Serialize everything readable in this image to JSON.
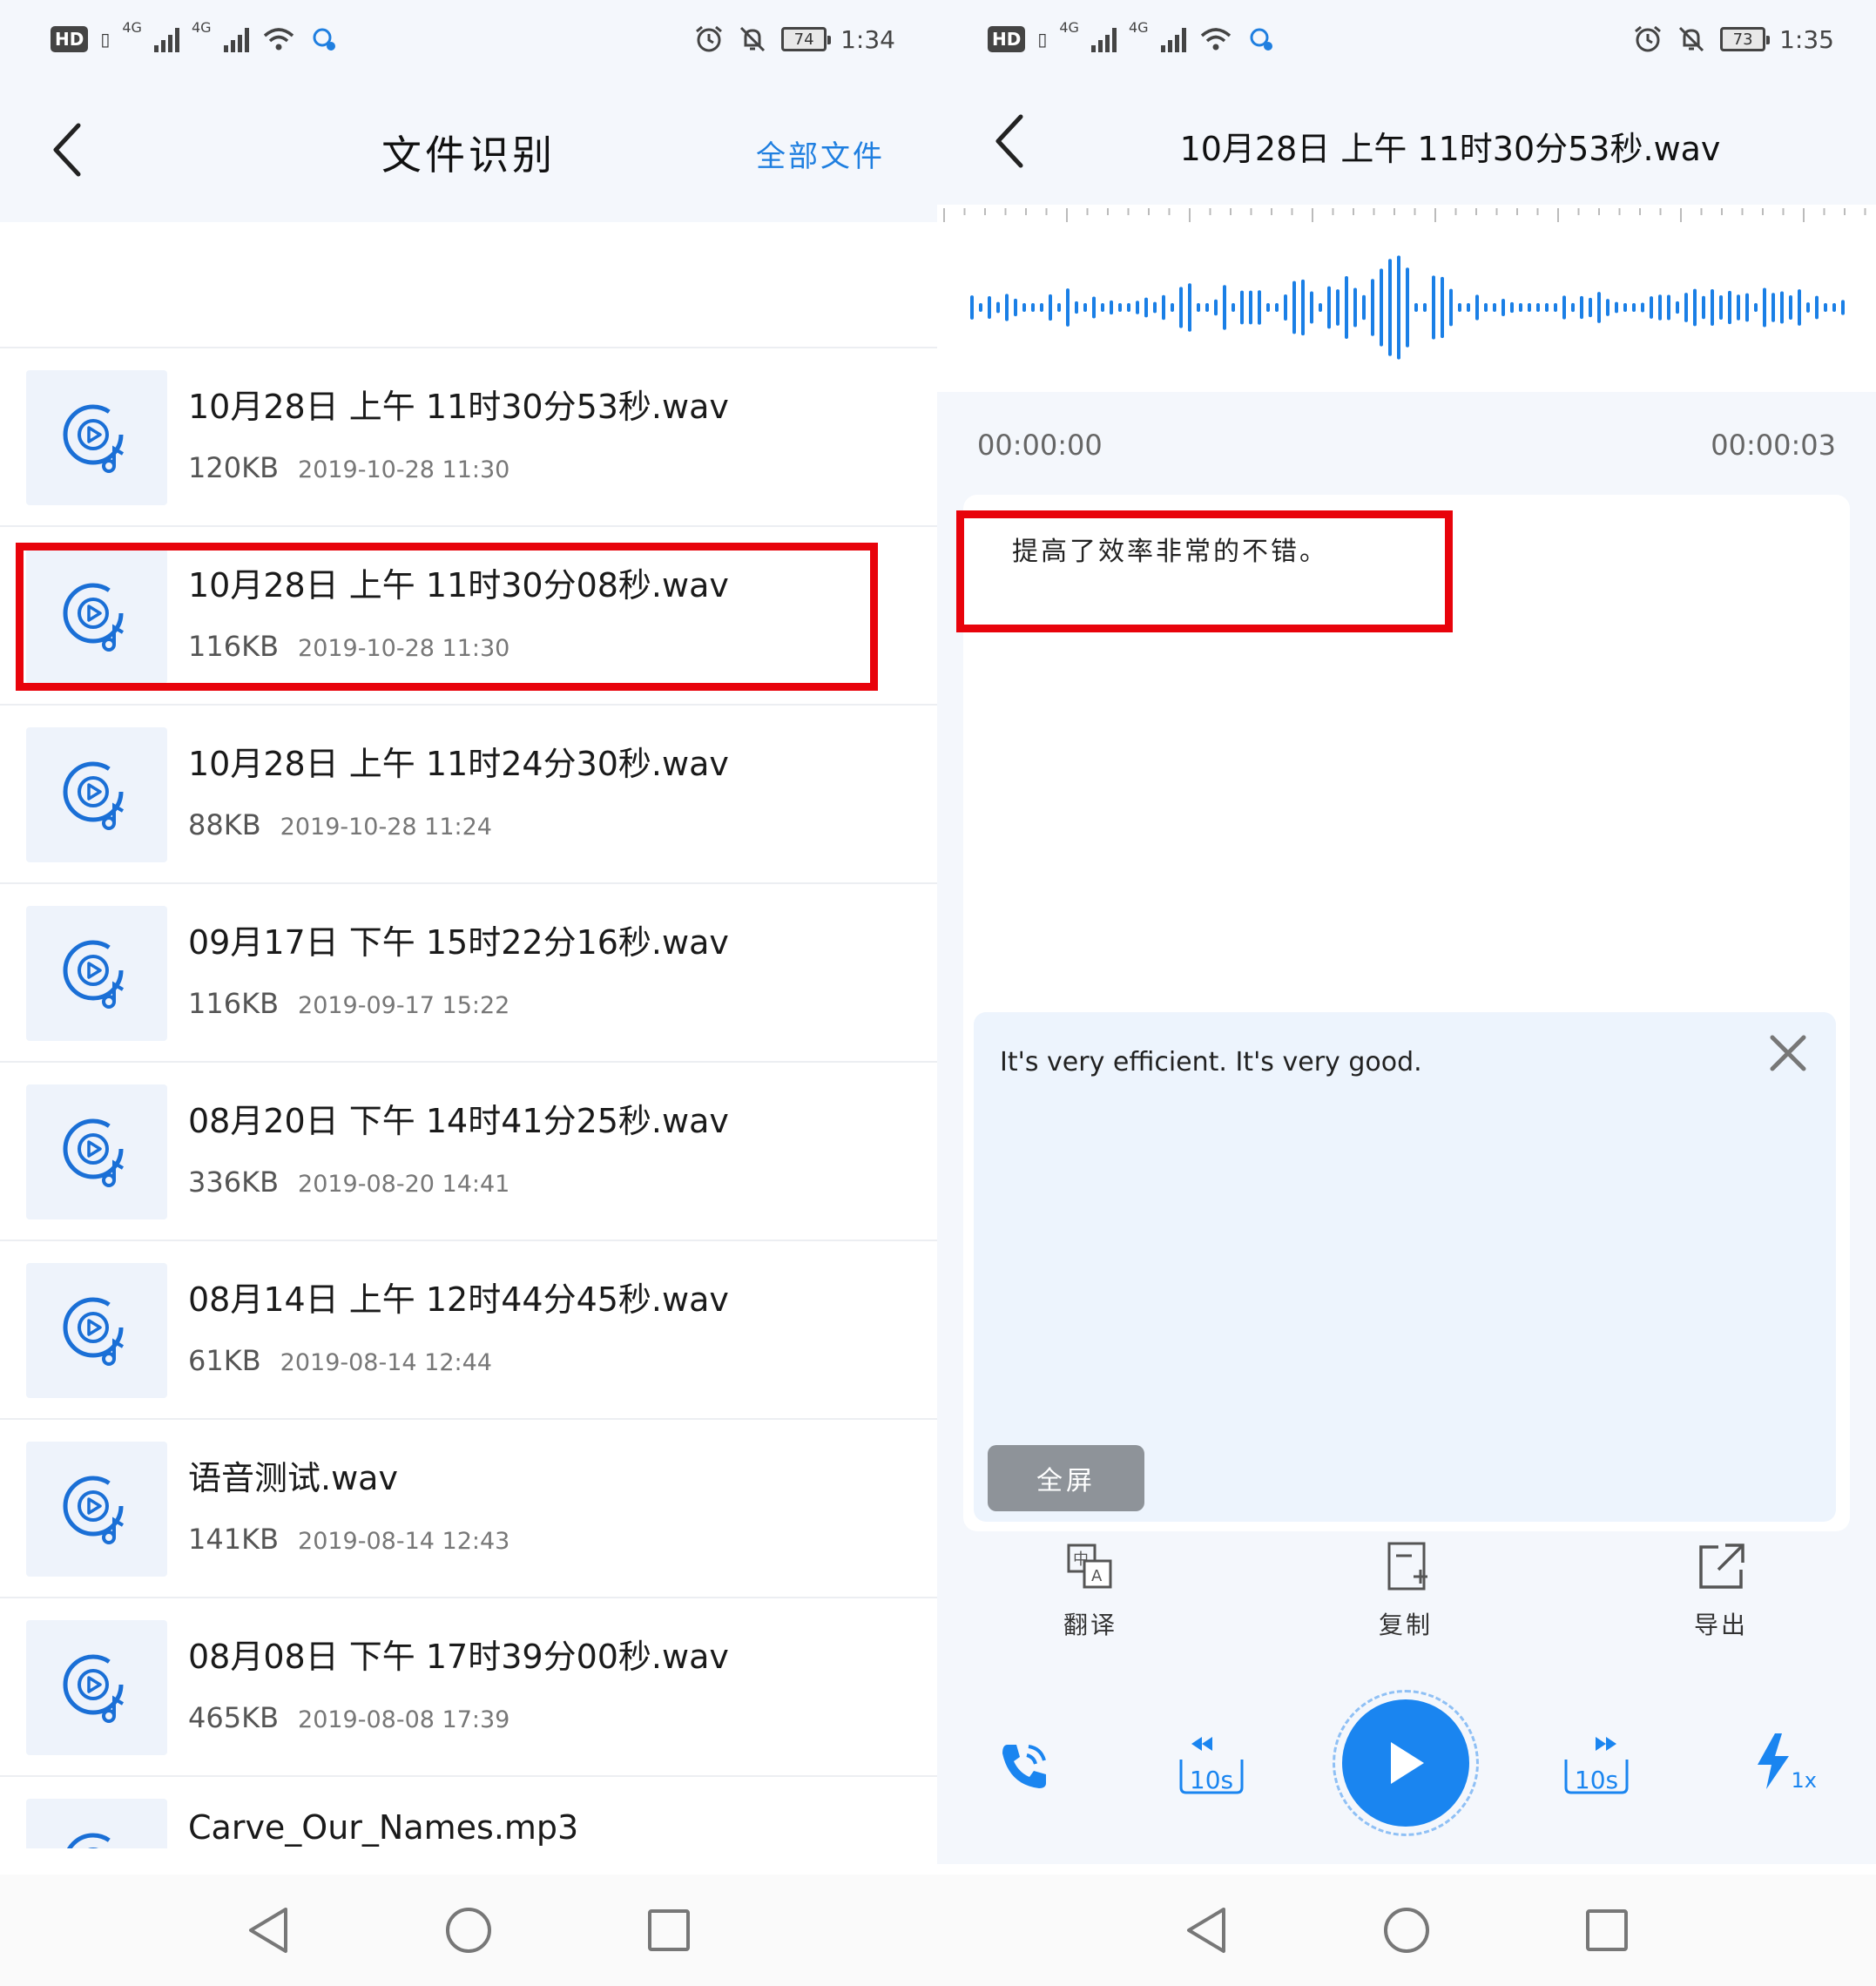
{
  "left_screen": {
    "status_bar": {
      "hd": "HD",
      "sim": "▯",
      "network_1": "4G",
      "network_2": "4G",
      "battery": "74",
      "time": "1:34"
    },
    "header": {
      "title": "文件识别",
      "all_files": "全部文件"
    },
    "files": [
      {
        "name": "10月28日 上午 11时30分53秒.wav",
        "size": "120KB",
        "date": "2019-10-28 11:30"
      },
      {
        "name": "10月28日 上午 11时30分08秒.wav",
        "size": "116KB",
        "date": "2019-10-28 11:30"
      },
      {
        "name": "10月28日 上午 11时24分30秒.wav",
        "size": "88KB",
        "date": "2019-10-28 11:24"
      },
      {
        "name": "09月17日 下午 15时22分16秒.wav",
        "size": "116KB",
        "date": "2019-09-17 15:22"
      },
      {
        "name": "08月20日 下午 14时41分25秒.wav",
        "size": "336KB",
        "date": "2019-08-20 14:41"
      },
      {
        "name": "08月14日 上午 12时44分45秒.wav",
        "size": "61KB",
        "date": "2019-08-14 12:44"
      },
      {
        "name": "语音测试.wav",
        "size": "141KB",
        "date": "2019-08-14 12:43"
      },
      {
        "name": "08月08日 下午 17时39分00秒.wav",
        "size": "465KB",
        "date": "2019-08-08 17:39"
      },
      {
        "name": "Carve_Our_Names.mp3",
        "size": "",
        "date": ""
      }
    ],
    "highlighted_index": 1
  },
  "right_screen": {
    "status_bar": {
      "hd": "HD",
      "sim": "▯",
      "network_1": "4G",
      "network_2": "4G",
      "battery": "73",
      "time": "1:35"
    },
    "header": {
      "title": "10月28日 上午 11时30分53秒.wav"
    },
    "playback": {
      "time_start": "00:00:00",
      "time_end": "00:00:03"
    },
    "transcript": "提高了效率非常的不错。",
    "translation": {
      "text": "It's very efficient. It's very good.",
      "fullscreen_label": "全屏"
    },
    "actions": {
      "translate_label": "翻译",
      "copy_label": "复制",
      "export_label": "导出"
    },
    "controls": {
      "back_label": "10s",
      "forward_label": "10s",
      "speed_label": "1x"
    }
  },
  "colors": {
    "accent": "#1a85f0",
    "highlight": "#e8030b",
    "header_bg": "#f4f7fc"
  },
  "icons": [
    "back-chevron-icon",
    "audio-file-icon",
    "close-icon",
    "translate-icon",
    "copy-icon",
    "export-icon",
    "phone-icon",
    "rewind-10s-icon",
    "play-icon",
    "forward-10s-icon",
    "speed-icon",
    "nav-back-icon",
    "nav-home-icon",
    "nav-recents-icon"
  ]
}
